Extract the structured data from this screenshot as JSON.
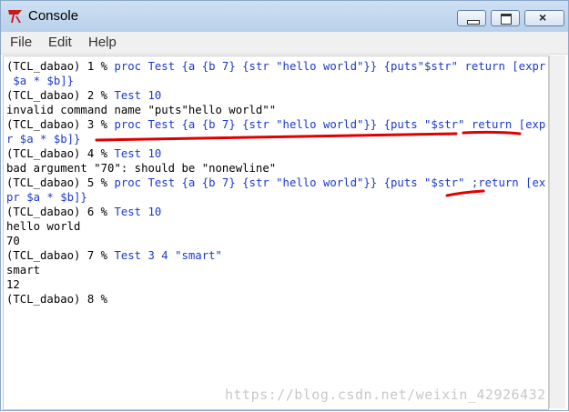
{
  "window": {
    "title": "Console",
    "app_icon": "tk-feather-icon",
    "controls": [
      "minimize-icon",
      "maximize-icon",
      "close-icon"
    ]
  },
  "menu": [
    "File",
    "Edit",
    "Help"
  ],
  "console_lines": [
    {
      "prompt": "(TCL_dabao) 1 % ",
      "text": "proc Test {a {b 7} {str \"hello world\"}} {puts\"$str\" return [expr",
      "type": "command"
    },
    {
      "prompt": "",
      "text": " $a * $b]}",
      "type": "command"
    },
    {
      "prompt": "(TCL_dabao) 2 % ",
      "text": "Test 10",
      "type": "command"
    },
    {
      "prompt": "",
      "text": "invalid command name \"puts\"hello world\"\"",
      "type": "output"
    },
    {
      "prompt": "(TCL_dabao) 3 % ",
      "text": "proc Test {a {b 7} {str \"hello world\"}} {puts \"$str\" return [exp",
      "type": "command"
    },
    {
      "prompt": "",
      "text": "r $a * $b]}",
      "type": "command"
    },
    {
      "prompt": "(TCL_dabao) 4 % ",
      "text": "Test 10",
      "type": "command"
    },
    {
      "prompt": "",
      "text": "bad argument \"70\": should be \"nonewline\"",
      "type": "output"
    },
    {
      "prompt": "(TCL_dabao) 5 % ",
      "text": "proc Test {a {b 7} {str \"hello world\"}} {puts \"$str\" ;return [ex",
      "type": "command"
    },
    {
      "prompt": "",
      "text": "pr $a * $b]}",
      "type": "command"
    },
    {
      "prompt": "(TCL_dabao) 6 % ",
      "text": "Test 10",
      "type": "command"
    },
    {
      "prompt": "",
      "text": "hello world",
      "type": "output"
    },
    {
      "prompt": "",
      "text": "70",
      "type": "output"
    },
    {
      "prompt": "(TCL_dabao) 7 % ",
      "text": "Test 3 4 \"smart\"",
      "type": "command"
    },
    {
      "prompt": "",
      "text": "smart",
      "type": "output"
    },
    {
      "prompt": "",
      "text": "12",
      "type": "output"
    },
    {
      "prompt": "(TCL_dabao) 8 % ",
      "text": "",
      "type": "command"
    }
  ],
  "watermark": "https://blog.csdn.net/weixin_42926432",
  "colors": {
    "command": "#1d3acb",
    "output": "#000000",
    "annotation": "#e00000"
  }
}
